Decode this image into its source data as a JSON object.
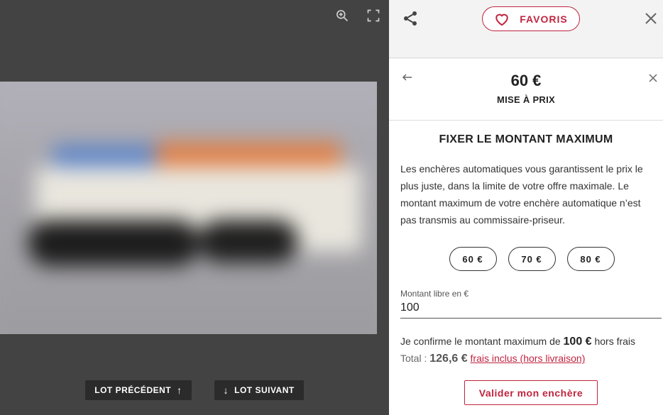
{
  "viewer": {
    "zoom_icon": "zoom-in-icon",
    "fullscreen_icon": "fullscreen-icon",
    "prev_label": "LOT PRÉCÉDENT",
    "next_label": "LOT SUIVANT",
    "prev_arrow": "↑",
    "next_arrow": "↓"
  },
  "panel": {
    "share_icon": "share-icon",
    "favorites_label": "FAVORIS",
    "close_icon": "close-icon"
  },
  "bid": {
    "price": "60 €",
    "price_label": "MISE À PRIX",
    "section_title": "FIXER LE MONTANT MAXIMUM",
    "description": "Les enchères automatiques vous garantissent le prix le plus juste, dans la limite de votre offre maximale. Le montant maximum de votre enchère automatique n’est pas transmis au commissaire-priseur.",
    "amounts": [
      "60 €",
      "70 €",
      "80 €"
    ],
    "free_label": "Montant libre en €",
    "free_value": "100",
    "confirm_prefix": "Je confirme le montant maximum de",
    "confirm_amount": "100 €",
    "confirm_suffix": "hors frais",
    "total_label": "Total :",
    "total_value": "126,6 €",
    "total_link": "frais inclus (hors livraison)",
    "validate_label": "Valider mon enchère"
  },
  "colors": {
    "accent": "#c0243f",
    "viewer_bg": "#434343",
    "nav_button_bg": "#2b2b2b"
  }
}
